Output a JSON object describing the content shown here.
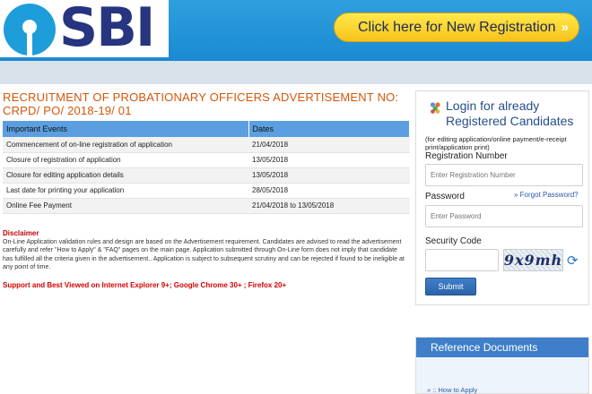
{
  "header": {
    "logo_text": "SBI",
    "registration_button": "Click here for New Registration",
    "registration_chevron": "»"
  },
  "title": "RECRUITMENT OF PROBATIONARY OFFICERS ADVERTISEMENT NO: CRPD/ PO/ 2018-19/ 01",
  "events_table": {
    "headers": [
      "Important Events",
      "Dates"
    ],
    "rows": [
      [
        "Commencement of on-line registration of application",
        "21/04/2018"
      ],
      [
        "Closure of registration of application",
        "13/05/2018"
      ],
      [
        "Closure for editing application details",
        "13/05/2018"
      ],
      [
        "Last date for printing your application",
        "28/05/2018"
      ],
      [
        "Online Fee Payment",
        "21/04/2018 to 13/05/2018"
      ]
    ]
  },
  "disclaimer": {
    "title": "Disclaimer",
    "text": "On-Line Application validation rules and design are based on the Advertisement requirement. Candidates are advised to read the advertisement carefully and refer \"How to Apply\" & \"FAQ\" pages on the main page. Application submitted through On-Line form does not imply that candidate has fulfilled all the criteria given in the advertisement.. Application is subject to subsequent scrutiny and can be rejected if found to be ineligible at any point of time."
  },
  "support_text": "Support and Best Viewed on Internet Explorer 9+; Google Chrome 30+ ; Firefox 20+",
  "login": {
    "title_line1": "Login for already",
    "title_line2": "Registered Candidates",
    "note": "(for editing application/online payment/e-receipt print/application print)",
    "registration_label": "Registration Number",
    "registration_placeholder": "Enter Registration Number",
    "password_label": "Password",
    "forgot_password": "» Forgot Password?",
    "password_placeholder": "Enter Password",
    "security_label": "Security Code",
    "captcha_text": "9x9mh",
    "submit_label": "Submit"
  },
  "reference": {
    "title": "Reference Documents",
    "link": "» :: How to Apply"
  }
}
